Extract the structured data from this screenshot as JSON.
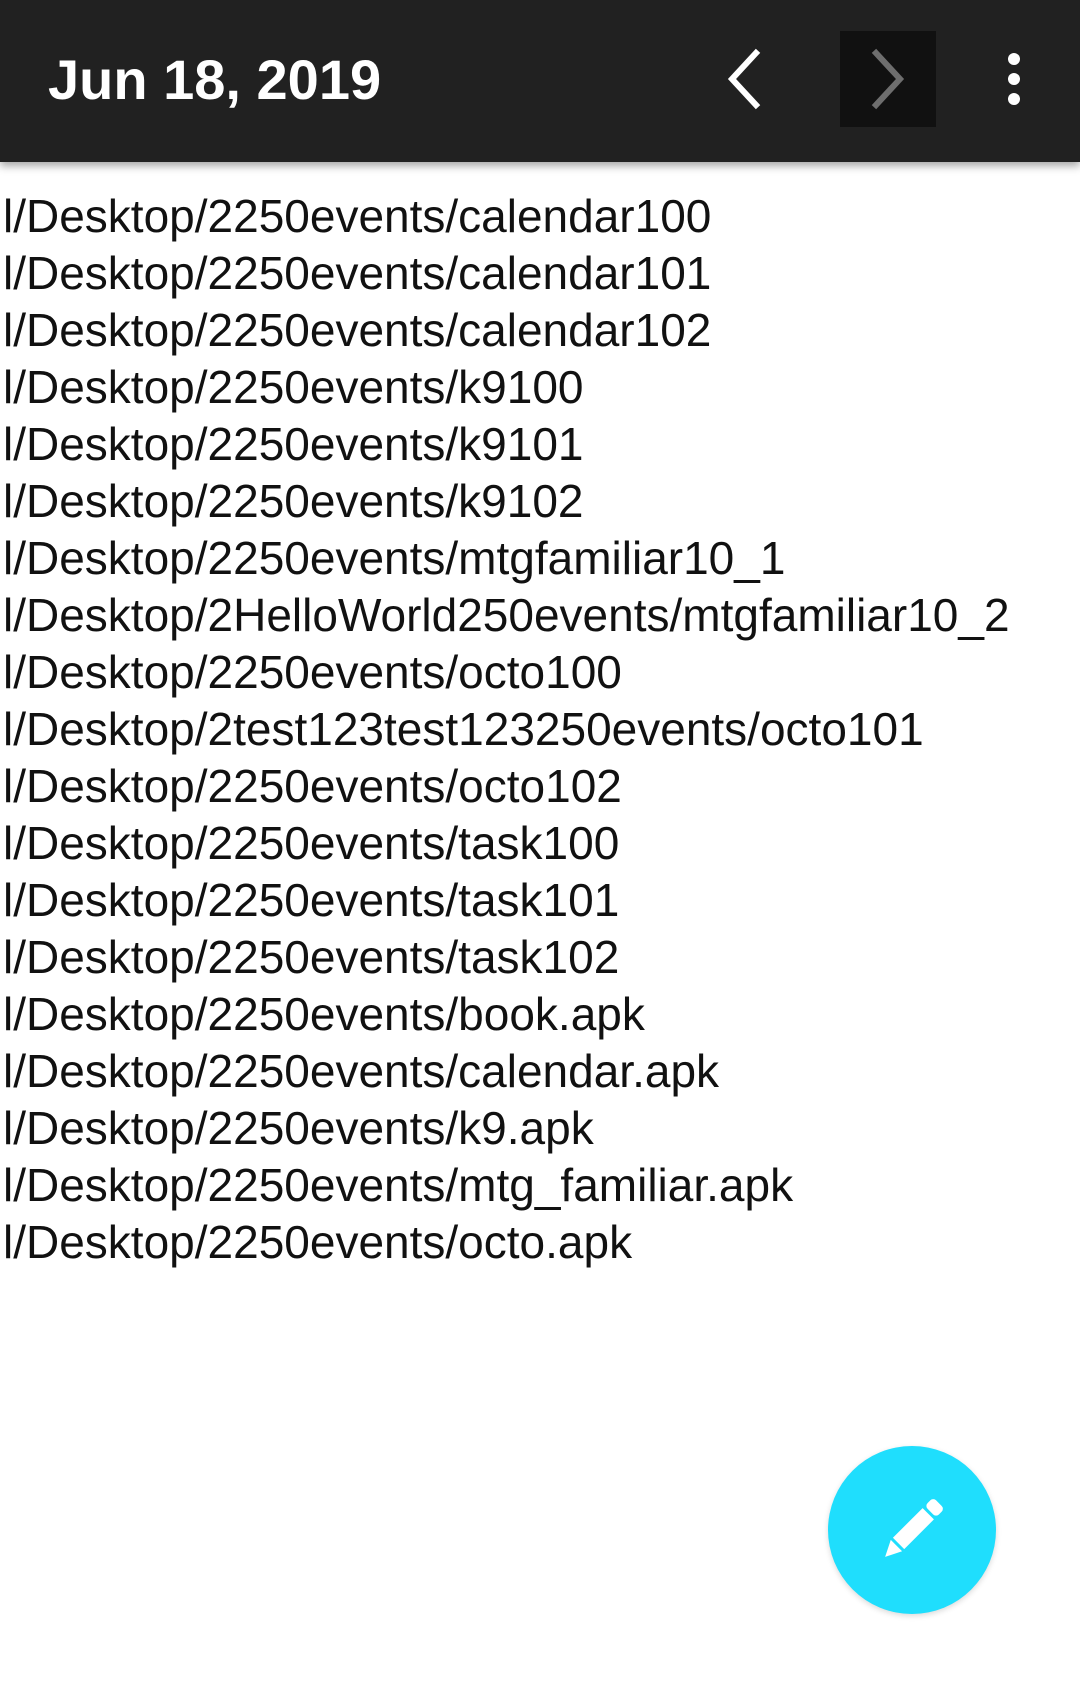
{
  "toolbar": {
    "title": "Jun 18, 2019",
    "prev_icon": "chevron-left-icon",
    "next_icon": "chevron-right-icon",
    "more_icon": "more-vert-icon"
  },
  "lines": [
    "l/Desktop/2250events/calendar100",
    "l/Desktop/2250events/calendar101",
    "l/Desktop/2250events/calendar102",
    "l/Desktop/2250events/k9100",
    "l/Desktop/2250events/k9101",
    "l/Desktop/2250events/k9102",
    "l/Desktop/2250events/mtgfamiliar10_1",
    "l/Desktop/2HelloWorld250events/mtgfamiliar10_2",
    "l/Desktop/2250events/octo100",
    "l/Desktop/2test123test123250events/octo101",
    "l/Desktop/2250events/octo102",
    "l/Desktop/2250events/task100",
    "l/Desktop/2250events/task101",
    "l/Desktop/2250events/task102",
    "l/Desktop/2250events/book.apk",
    "l/Desktop/2250events/calendar.apk",
    "l/Desktop/2250events/k9.apk",
    "l/Desktop/2250events/mtg_familiar.apk",
    "l/Desktop/2250events/octo.apk"
  ],
  "fab": {
    "icon": "pencil-icon",
    "color": "#1fdefd"
  },
  "colors": {
    "toolbar": "#212121",
    "accent": "#1fdefd"
  }
}
